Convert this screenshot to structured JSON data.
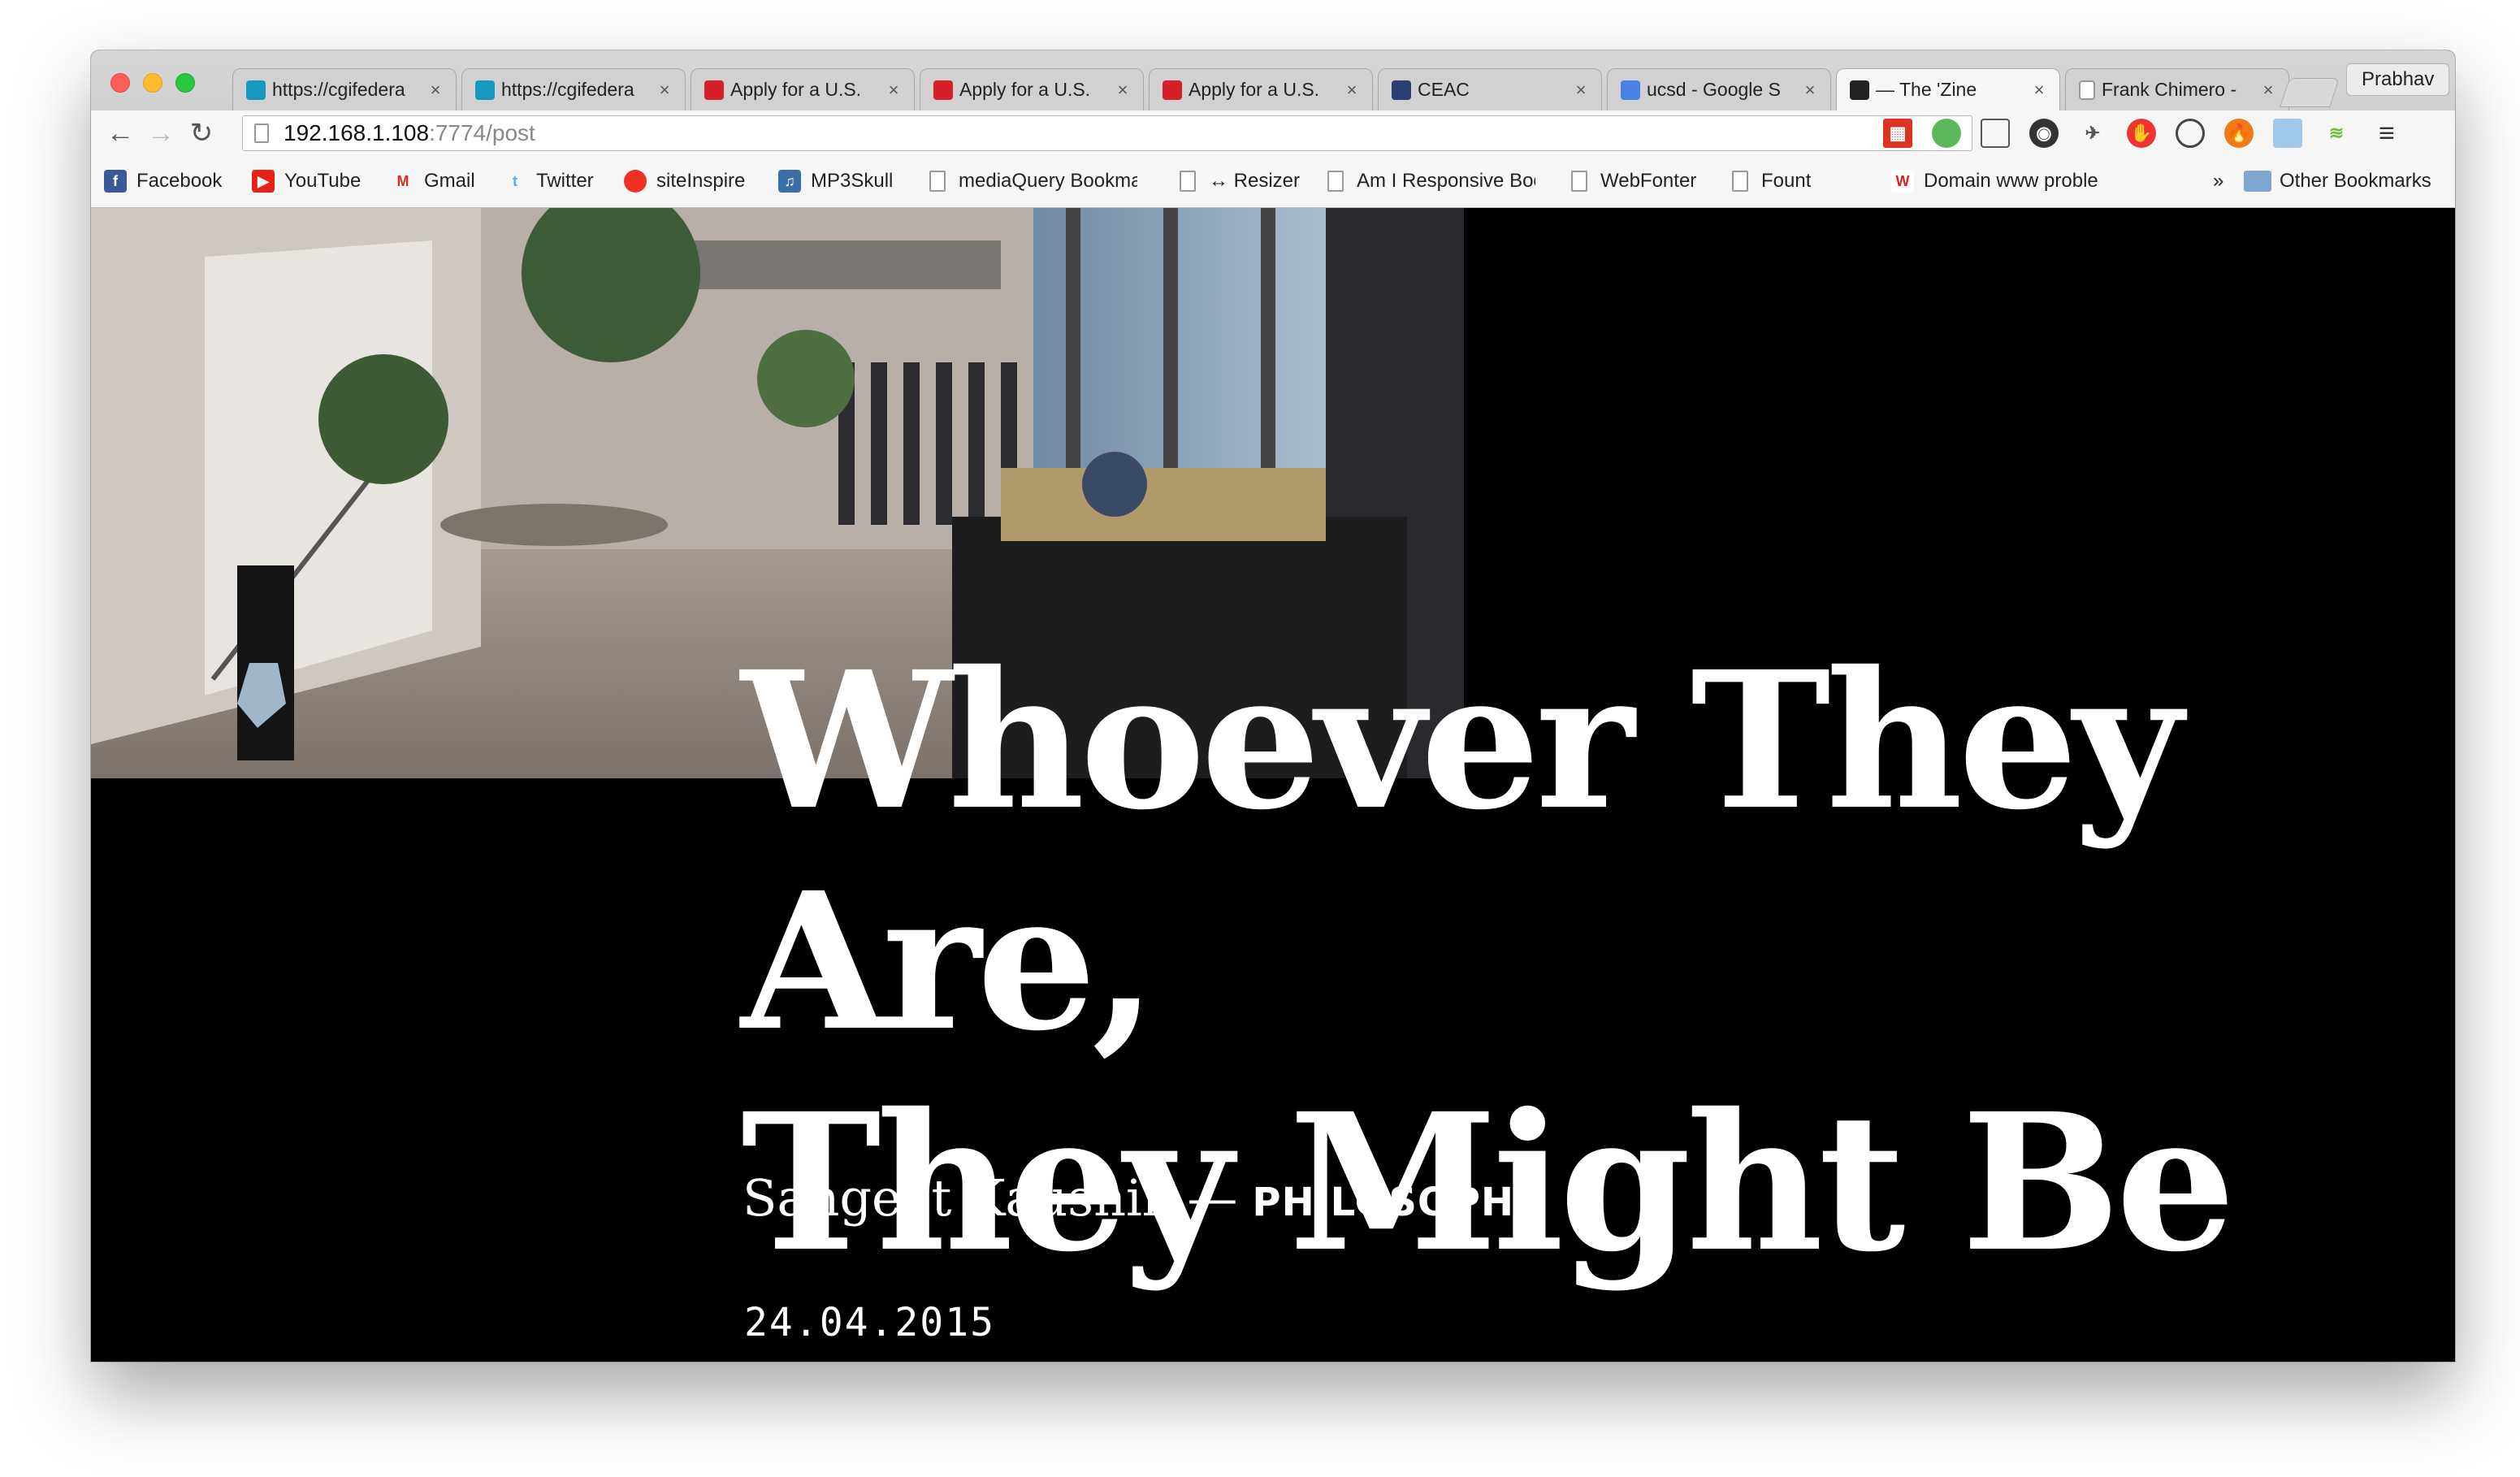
{
  "browser": {
    "tabs": [
      {
        "title": "https://cgifedera",
        "favicon": "salesforce-cloud-icon",
        "color": "#1798c1"
      },
      {
        "title": "https://cgifedera",
        "favicon": "salesforce-cloud-icon",
        "color": "#1798c1"
      },
      {
        "title": "Apply for a U.S.",
        "favicon": "cgi-logo-icon",
        "color": "#d5202a"
      },
      {
        "title": "Apply for a U.S.",
        "favicon": "cgi-logo-icon",
        "color": "#d5202a"
      },
      {
        "title": "Apply for a U.S.",
        "favicon": "cgi-logo-icon",
        "color": "#d5202a"
      },
      {
        "title": "CEAC",
        "favicon": "state-seal-icon",
        "color": "#2a3e72"
      },
      {
        "title": "ucsd - Google S",
        "favicon": "google-icon",
        "color": "#4a82e6"
      },
      {
        "title": "— The 'Zine",
        "favicon": "zine-logo-icon",
        "color": "#222222"
      },
      {
        "title": "Frank Chimero -",
        "favicon": "page-icon",
        "color": "#ffffff"
      }
    ],
    "active_tab_index": 7,
    "profile_name": "Prabhav",
    "url_host": "192.168.1.108",
    "url_path": ":7774/post",
    "bookmarks": [
      {
        "label": "Facebook",
        "icon": "facebook-icon",
        "color": "#3b5998",
        "glyph": "f"
      },
      {
        "label": "YouTube",
        "icon": "youtube-icon",
        "color": "#e62117",
        "glyph": "▶"
      },
      {
        "label": "Gmail",
        "icon": "gmail-icon",
        "color": "#d93025",
        "glyph": "M"
      },
      {
        "label": "Twitter",
        "icon": "twitter-icon",
        "color": "#55acee",
        "glyph": "t"
      },
      {
        "label": "siteInspire",
        "icon": "siteinspire-icon",
        "color": "#ee3124",
        "glyph": ""
      },
      {
        "label": "MP3Skull",
        "icon": "mp3skull-icon",
        "color": "#3a6fa8",
        "glyph": "♫"
      },
      {
        "label": "mediaQuery Bookma",
        "icon": "page-icon"
      },
      {
        "label": "↔ Resizer",
        "icon": "page-icon"
      },
      {
        "label": "Am I Responsive Boo",
        "icon": "page-icon"
      },
      {
        "label": "WebFonter",
        "icon": "page-icon"
      },
      {
        "label": "Fount",
        "icon": "page-icon"
      },
      {
        "label": "Domain www proble",
        "icon": "w-icon",
        "color": "#ffffff",
        "glyph": "W"
      }
    ],
    "overflow_chevron": "»",
    "other_bookmarks": "Other Bookmarks"
  },
  "post": {
    "title_line1": "Whoever They Are,",
    "title_line2": "They Might Be",
    "author": "Sangeet Kaushik",
    "separator": "—",
    "category": "PHILOSOPHY",
    "date": "24.04.2015"
  }
}
